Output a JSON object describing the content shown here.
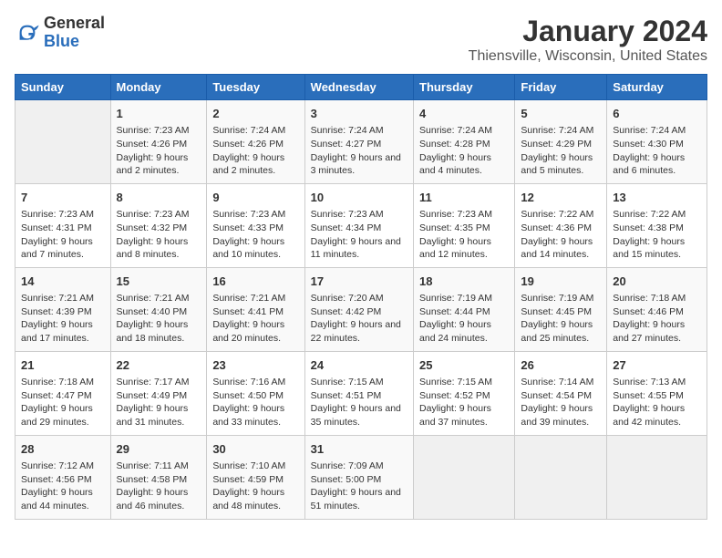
{
  "logo": {
    "general": "General",
    "blue": "Blue"
  },
  "title": "January 2024",
  "subtitle": "Thiensville, Wisconsin, United States",
  "days_of_week": [
    "Sunday",
    "Monday",
    "Tuesday",
    "Wednesday",
    "Thursday",
    "Friday",
    "Saturday"
  ],
  "weeks": [
    [
      {
        "day": "",
        "sunrise": "",
        "sunset": "",
        "daylight": ""
      },
      {
        "day": "1",
        "sunrise": "Sunrise: 7:23 AM",
        "sunset": "Sunset: 4:26 PM",
        "daylight": "Daylight: 9 hours and 2 minutes."
      },
      {
        "day": "2",
        "sunrise": "Sunrise: 7:24 AM",
        "sunset": "Sunset: 4:26 PM",
        "daylight": "Daylight: 9 hours and 2 minutes."
      },
      {
        "day": "3",
        "sunrise": "Sunrise: 7:24 AM",
        "sunset": "Sunset: 4:27 PM",
        "daylight": "Daylight: 9 hours and 3 minutes."
      },
      {
        "day": "4",
        "sunrise": "Sunrise: 7:24 AM",
        "sunset": "Sunset: 4:28 PM",
        "daylight": "Daylight: 9 hours and 4 minutes."
      },
      {
        "day": "5",
        "sunrise": "Sunrise: 7:24 AM",
        "sunset": "Sunset: 4:29 PM",
        "daylight": "Daylight: 9 hours and 5 minutes."
      },
      {
        "day": "6",
        "sunrise": "Sunrise: 7:24 AM",
        "sunset": "Sunset: 4:30 PM",
        "daylight": "Daylight: 9 hours and 6 minutes."
      }
    ],
    [
      {
        "day": "7",
        "sunrise": "Sunrise: 7:23 AM",
        "sunset": "Sunset: 4:31 PM",
        "daylight": "Daylight: 9 hours and 7 minutes."
      },
      {
        "day": "8",
        "sunrise": "Sunrise: 7:23 AM",
        "sunset": "Sunset: 4:32 PM",
        "daylight": "Daylight: 9 hours and 8 minutes."
      },
      {
        "day": "9",
        "sunrise": "Sunrise: 7:23 AM",
        "sunset": "Sunset: 4:33 PM",
        "daylight": "Daylight: 9 hours and 10 minutes."
      },
      {
        "day": "10",
        "sunrise": "Sunrise: 7:23 AM",
        "sunset": "Sunset: 4:34 PM",
        "daylight": "Daylight: 9 hours and 11 minutes."
      },
      {
        "day": "11",
        "sunrise": "Sunrise: 7:23 AM",
        "sunset": "Sunset: 4:35 PM",
        "daylight": "Daylight: 9 hours and 12 minutes."
      },
      {
        "day": "12",
        "sunrise": "Sunrise: 7:22 AM",
        "sunset": "Sunset: 4:36 PM",
        "daylight": "Daylight: 9 hours and 14 minutes."
      },
      {
        "day": "13",
        "sunrise": "Sunrise: 7:22 AM",
        "sunset": "Sunset: 4:38 PM",
        "daylight": "Daylight: 9 hours and 15 minutes."
      }
    ],
    [
      {
        "day": "14",
        "sunrise": "Sunrise: 7:21 AM",
        "sunset": "Sunset: 4:39 PM",
        "daylight": "Daylight: 9 hours and 17 minutes."
      },
      {
        "day": "15",
        "sunrise": "Sunrise: 7:21 AM",
        "sunset": "Sunset: 4:40 PM",
        "daylight": "Daylight: 9 hours and 18 minutes."
      },
      {
        "day": "16",
        "sunrise": "Sunrise: 7:21 AM",
        "sunset": "Sunset: 4:41 PM",
        "daylight": "Daylight: 9 hours and 20 minutes."
      },
      {
        "day": "17",
        "sunrise": "Sunrise: 7:20 AM",
        "sunset": "Sunset: 4:42 PM",
        "daylight": "Daylight: 9 hours and 22 minutes."
      },
      {
        "day": "18",
        "sunrise": "Sunrise: 7:19 AM",
        "sunset": "Sunset: 4:44 PM",
        "daylight": "Daylight: 9 hours and 24 minutes."
      },
      {
        "day": "19",
        "sunrise": "Sunrise: 7:19 AM",
        "sunset": "Sunset: 4:45 PM",
        "daylight": "Daylight: 9 hours and 25 minutes."
      },
      {
        "day": "20",
        "sunrise": "Sunrise: 7:18 AM",
        "sunset": "Sunset: 4:46 PM",
        "daylight": "Daylight: 9 hours and 27 minutes."
      }
    ],
    [
      {
        "day": "21",
        "sunrise": "Sunrise: 7:18 AM",
        "sunset": "Sunset: 4:47 PM",
        "daylight": "Daylight: 9 hours and 29 minutes."
      },
      {
        "day": "22",
        "sunrise": "Sunrise: 7:17 AM",
        "sunset": "Sunset: 4:49 PM",
        "daylight": "Daylight: 9 hours and 31 minutes."
      },
      {
        "day": "23",
        "sunrise": "Sunrise: 7:16 AM",
        "sunset": "Sunset: 4:50 PM",
        "daylight": "Daylight: 9 hours and 33 minutes."
      },
      {
        "day": "24",
        "sunrise": "Sunrise: 7:15 AM",
        "sunset": "Sunset: 4:51 PM",
        "daylight": "Daylight: 9 hours and 35 minutes."
      },
      {
        "day": "25",
        "sunrise": "Sunrise: 7:15 AM",
        "sunset": "Sunset: 4:52 PM",
        "daylight": "Daylight: 9 hours and 37 minutes."
      },
      {
        "day": "26",
        "sunrise": "Sunrise: 7:14 AM",
        "sunset": "Sunset: 4:54 PM",
        "daylight": "Daylight: 9 hours and 39 minutes."
      },
      {
        "day": "27",
        "sunrise": "Sunrise: 7:13 AM",
        "sunset": "Sunset: 4:55 PM",
        "daylight": "Daylight: 9 hours and 42 minutes."
      }
    ],
    [
      {
        "day": "28",
        "sunrise": "Sunrise: 7:12 AM",
        "sunset": "Sunset: 4:56 PM",
        "daylight": "Daylight: 9 hours and 44 minutes."
      },
      {
        "day": "29",
        "sunrise": "Sunrise: 7:11 AM",
        "sunset": "Sunset: 4:58 PM",
        "daylight": "Daylight: 9 hours and 46 minutes."
      },
      {
        "day": "30",
        "sunrise": "Sunrise: 7:10 AM",
        "sunset": "Sunset: 4:59 PM",
        "daylight": "Daylight: 9 hours and 48 minutes."
      },
      {
        "day": "31",
        "sunrise": "Sunrise: 7:09 AM",
        "sunset": "Sunset: 5:00 PM",
        "daylight": "Daylight: 9 hours and 51 minutes."
      },
      {
        "day": "",
        "sunrise": "",
        "sunset": "",
        "daylight": ""
      },
      {
        "day": "",
        "sunrise": "",
        "sunset": "",
        "daylight": ""
      },
      {
        "day": "",
        "sunrise": "",
        "sunset": "",
        "daylight": ""
      }
    ]
  ]
}
